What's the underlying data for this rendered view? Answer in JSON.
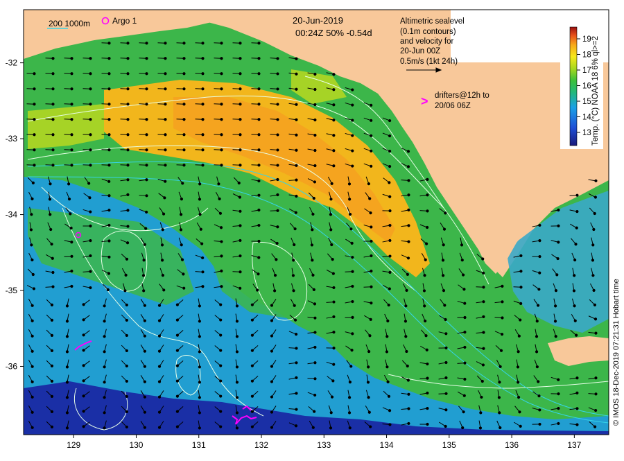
{
  "map": {
    "lon_ticks": [
      "129",
      "130",
      "131",
      "132",
      "133",
      "134",
      "135",
      "136",
      "137"
    ],
    "lat_ticks": [
      "-32",
      "-33",
      "-34",
      "-35",
      "-36"
    ],
    "lon_range": [
      128.2,
      137.55
    ],
    "lat_range": [
      -36.9,
      -31.3
    ]
  },
  "legend": {
    "depth_label": "200  1000m",
    "argo_label": "Argo 1"
  },
  "header": {
    "date": "20-Jun-2019",
    "time_line": "00:24Z  50% -0.54d"
  },
  "info": {
    "line1": "Altimetric sealevel",
    "line2": "(0.1m contours)",
    "line3": "and velocity for",
    "line4": "20-Jun 00Z",
    "line5": "0.5m/s (1kt 24h)"
  },
  "drifters": {
    "symbol": ">",
    "line1": "drifters@12h to",
    "line2": "20/06 06Z"
  },
  "colorbar": {
    "ticks": [
      "19",
      "18",
      "17",
      "16",
      "15",
      "14",
      "13"
    ],
    "label": "Temp. (°C) NOAA 18 6% ql>=2"
  },
  "credit": "© IMOS 18-Dec-2019 07:21:31 Hobart time",
  "colors": {
    "land": "#f8c89a",
    "warm": "#f7b71a",
    "mid": "#3cb64a",
    "cool": "#1e9be0",
    "cold": "#1a2fa6",
    "drifter": "#ff00ff",
    "contour": "#e8ffe8",
    "depth_contour": "#35d4e8"
  }
}
